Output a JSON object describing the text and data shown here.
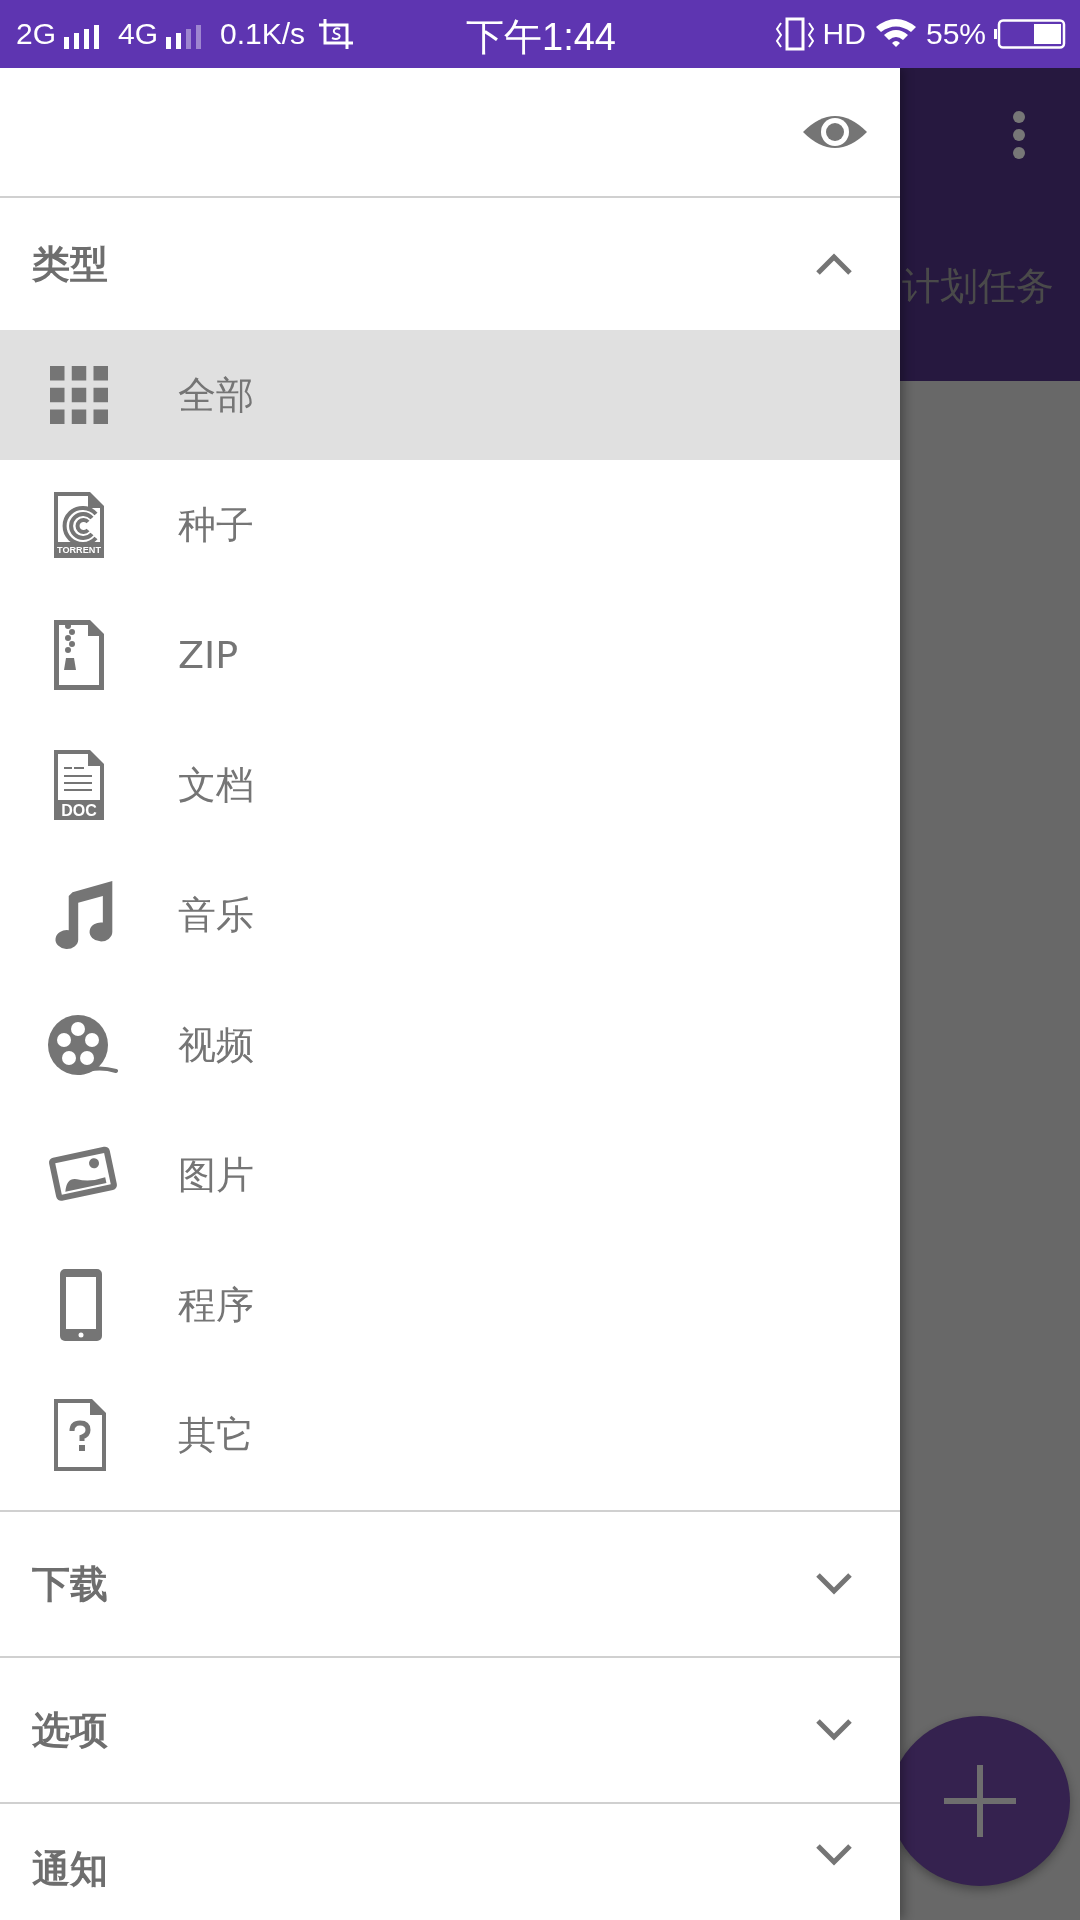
{
  "status_bar": {
    "network_1": "2G",
    "network_2": "4G",
    "speed": "0.1K/s",
    "time": "下午1:44",
    "hd": "HD",
    "battery": "55%"
  },
  "background": {
    "title": "计划任务"
  },
  "drawer": {
    "sections": [
      {
        "title": "类型",
        "expanded": true,
        "items": [
          {
            "kind": "all",
            "label": "全部",
            "selected": true
          },
          {
            "kind": "torrent",
            "label": "种子",
            "selected": false,
            "icon_text": "TORRENT"
          },
          {
            "kind": "zip",
            "label": "ZIP",
            "selected": false
          },
          {
            "kind": "doc",
            "label": "文档",
            "selected": false,
            "icon_text": "DOC"
          },
          {
            "kind": "music",
            "label": "音乐",
            "selected": false
          },
          {
            "kind": "video",
            "label": "视频",
            "selected": false
          },
          {
            "kind": "image",
            "label": "图片",
            "selected": false
          },
          {
            "kind": "app",
            "label": "程序",
            "selected": false
          },
          {
            "kind": "other",
            "label": "其它",
            "selected": false
          }
        ]
      },
      {
        "title": "下载",
        "expanded": false
      },
      {
        "title": "选项",
        "expanded": false
      },
      {
        "title": "通知",
        "expanded": false
      }
    ]
  }
}
